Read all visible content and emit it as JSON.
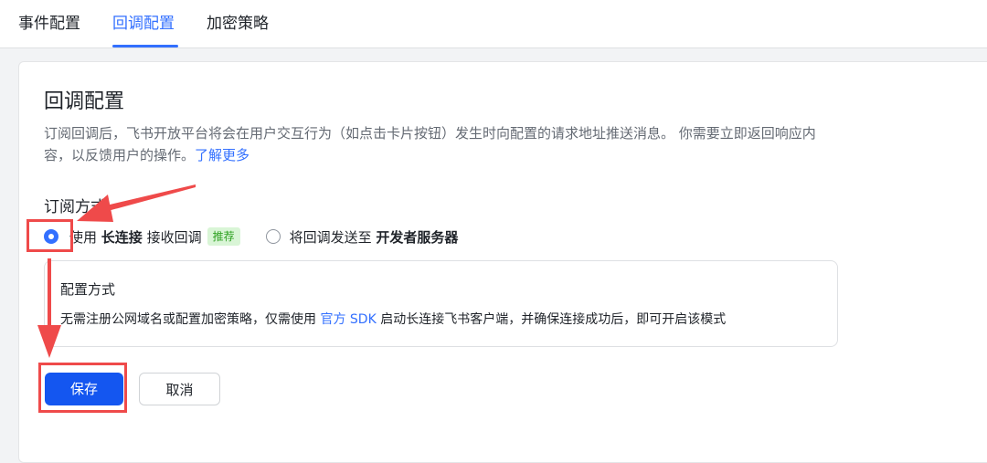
{
  "tabs": [
    {
      "label": "事件配置"
    },
    {
      "label": "回调配置"
    },
    {
      "label": "加密策略"
    }
  ],
  "active_tab": "回调配置",
  "section": {
    "title": "回调配置",
    "desc_line1": "订阅回调后，飞书开放平台将会在用户交互行为（如点击卡片按钮）发生时向配置的请求地址推送消息。 你需要立即返回响应内",
    "desc_line2": "容，以反馈用户的操作。",
    "learn_more": "了解更多"
  },
  "subscribe": {
    "label": "订阅方式",
    "option1": {
      "prefix": "使用 ",
      "bold": "长连接",
      "suffix": " 接收回调",
      "badge": "推荐",
      "checked": true
    },
    "option2": {
      "prefix": "将回调发送至 ",
      "bold": "开发者服务器",
      "checked": false
    }
  },
  "config": {
    "title": "配置方式",
    "text_before": "无需注册公网域名或配置加密策略，仅需使用 ",
    "link": "官方 SDK",
    "text_after": " 启动长连接飞书客户端，并确保连接成功后，即可开启该模式"
  },
  "buttons": {
    "save": "保存",
    "cancel": "取消"
  },
  "colors": {
    "accent": "#3370ff",
    "primary_button": "#1456f0",
    "annotation": "#ef4a4a",
    "badge_bg": "#d9f5d6",
    "badge_text": "#2ea121"
  }
}
